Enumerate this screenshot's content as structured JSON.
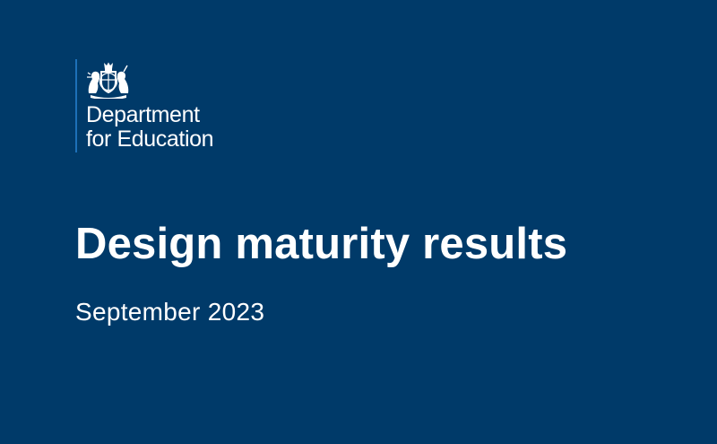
{
  "colors": {
    "background": "#003a69",
    "text": "#ffffff",
    "rule": "#1d70b8"
  },
  "logo": {
    "icon": "royal-coat-of-arms-icon",
    "line1": "Department",
    "line2": "for Education"
  },
  "title": "Design maturity results",
  "subtitle": "September 2023"
}
